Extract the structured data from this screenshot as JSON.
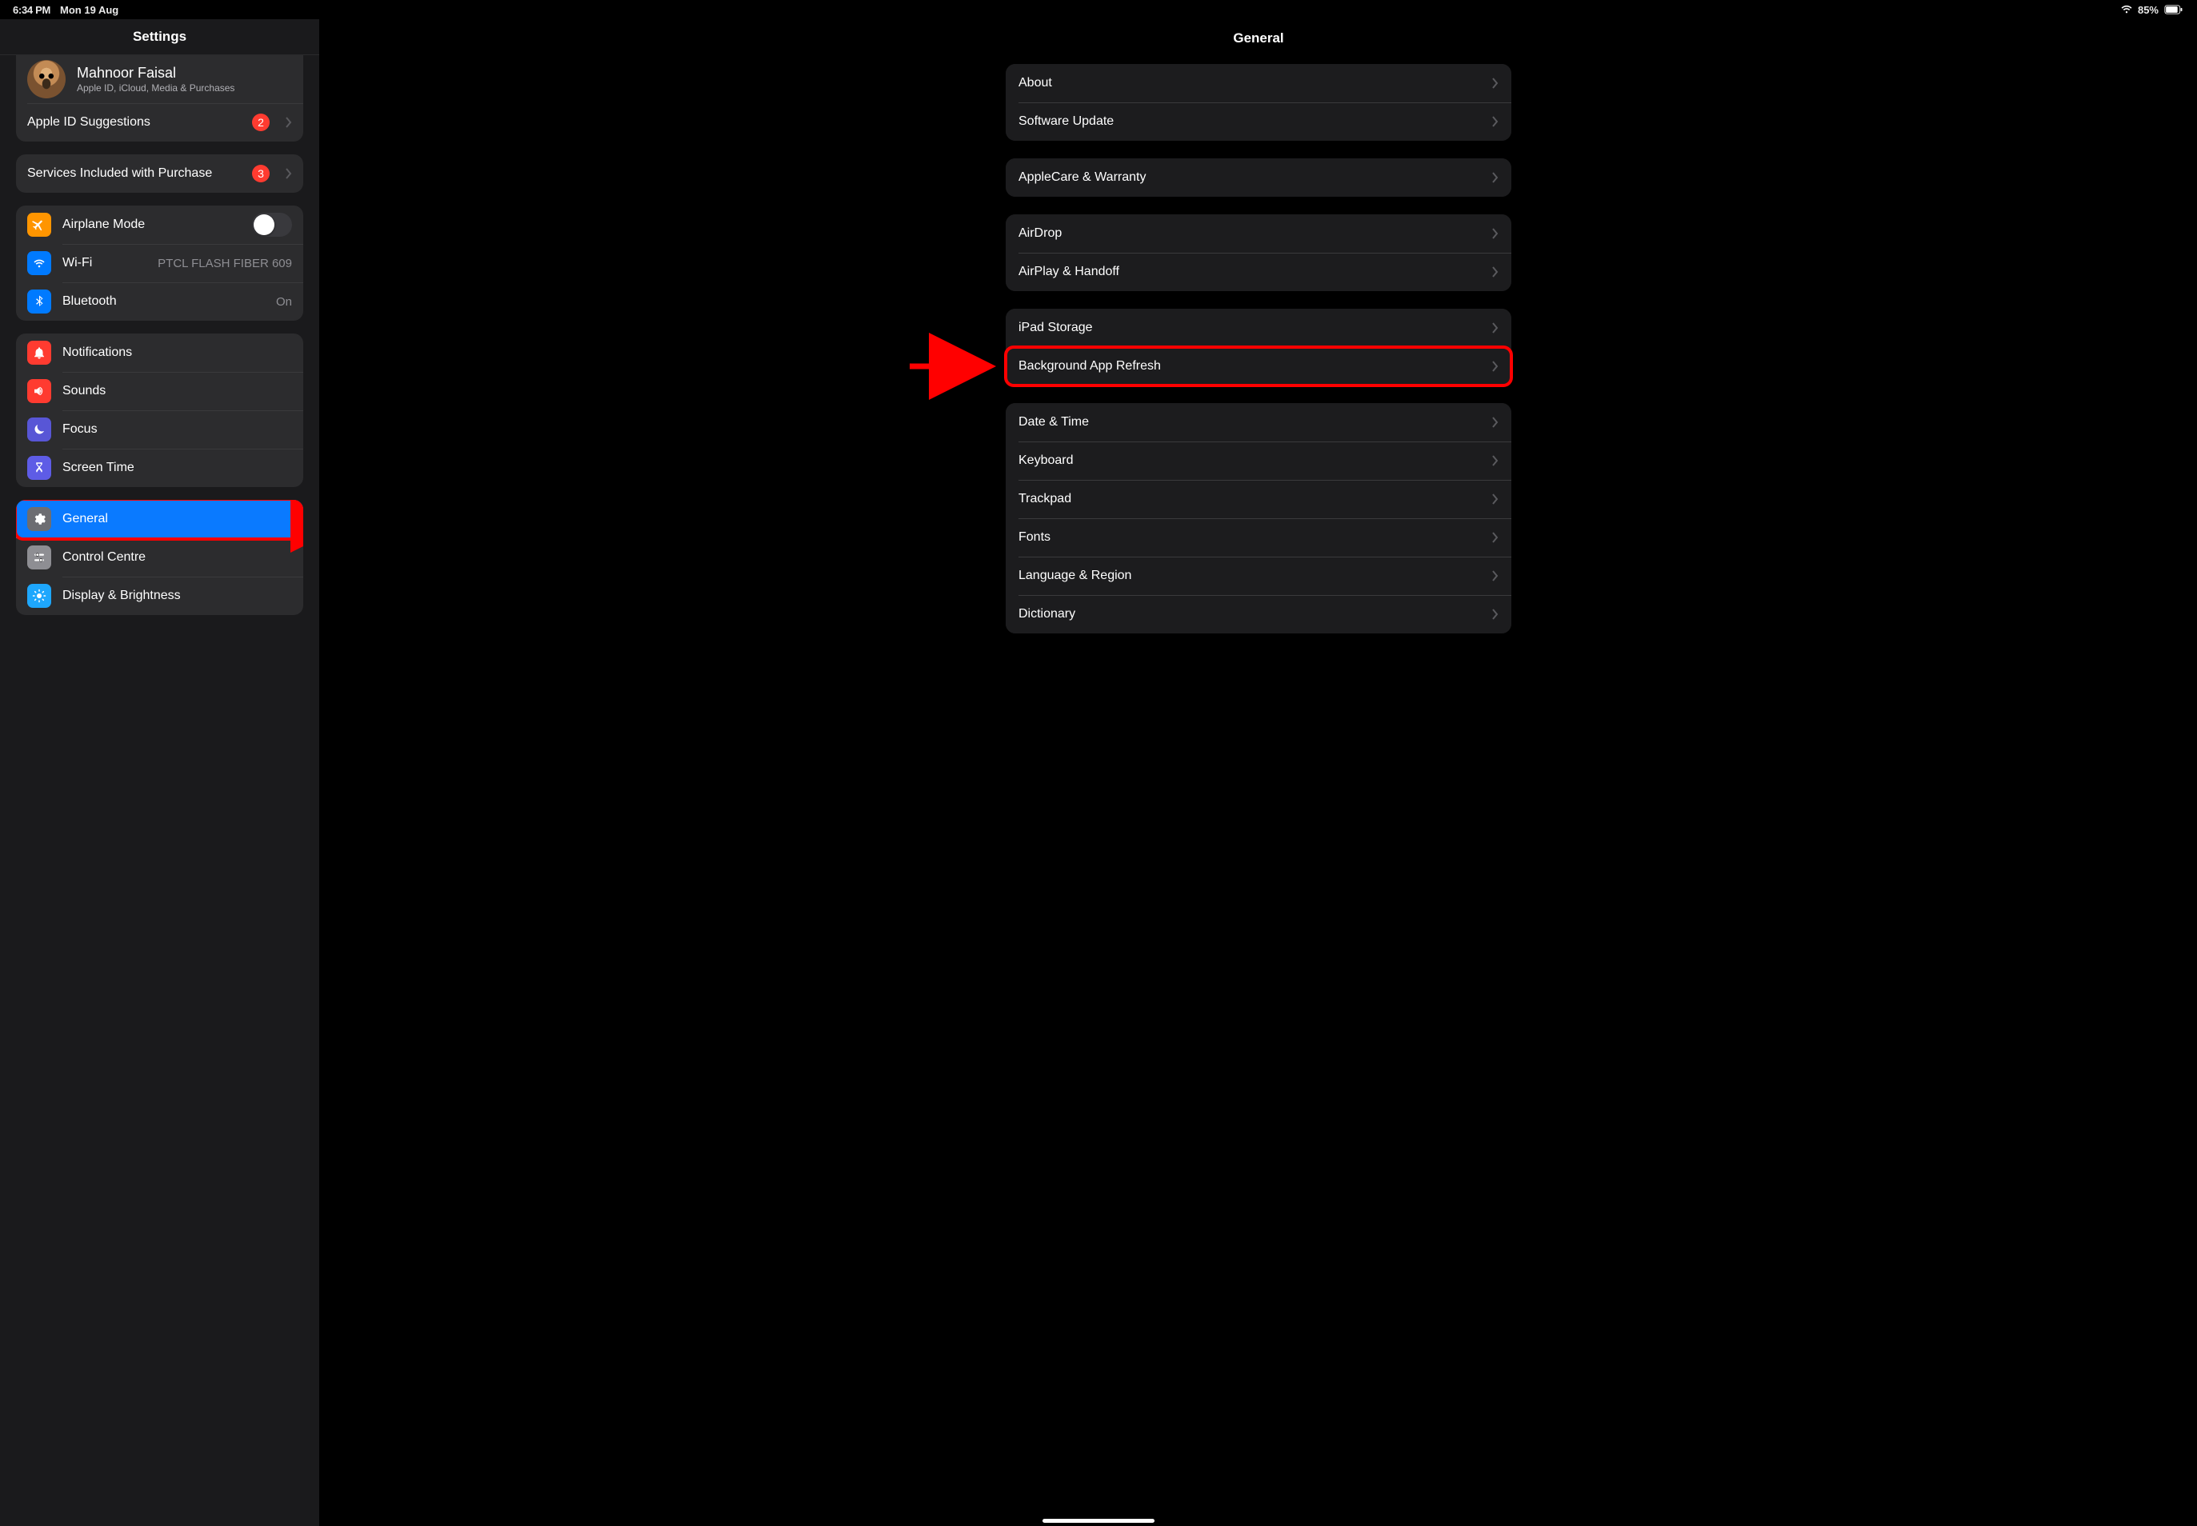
{
  "status": {
    "time": "6:34 PM",
    "date": "Mon 19 Aug",
    "battery": "85%"
  },
  "sidebar": {
    "title": "Settings",
    "account": {
      "name": "Mahnoor Faisal",
      "subtitle": "Apple ID, iCloud, Media & Purchases"
    },
    "apple_id_suggestions": {
      "label": "Apple ID Suggestions",
      "badge": "2"
    },
    "services": {
      "label": "Services Included with Purchase",
      "badge": "3"
    },
    "airplane": {
      "label": "Airplane Mode"
    },
    "wifi": {
      "label": "Wi-Fi",
      "value": "PTCL FLASH FIBER  609"
    },
    "bluetooth": {
      "label": "Bluetooth",
      "value": "On"
    },
    "notifications": {
      "label": "Notifications"
    },
    "sounds": {
      "label": "Sounds"
    },
    "focus": {
      "label": "Focus"
    },
    "screentime": {
      "label": "Screen Time"
    },
    "general": {
      "label": "General"
    },
    "controlcentre": {
      "label": "Control Centre"
    },
    "display": {
      "label": "Display & Brightness"
    }
  },
  "detail": {
    "title": "General",
    "about": "About",
    "software_update": "Software Update",
    "applecare": "AppleCare & Warranty",
    "airdrop": "AirDrop",
    "airplay": "AirPlay & Handoff",
    "storage": "iPad Storage",
    "background_refresh": "Background App Refresh",
    "datetime": "Date & Time",
    "keyboard": "Keyboard",
    "trackpad": "Trackpad",
    "fonts": "Fonts",
    "language": "Language & Region",
    "dictionary": "Dictionary"
  }
}
